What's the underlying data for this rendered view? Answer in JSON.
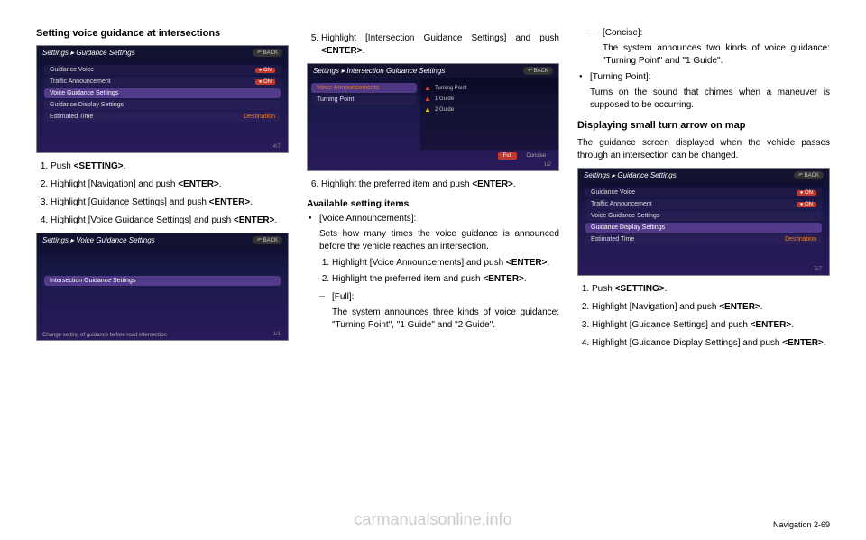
{
  "col1": {
    "heading": "Setting voice guidance at intersections",
    "screenshot1": {
      "title": "Settings",
      "crumb": "Guidance Settings",
      "back": "BACK",
      "items": [
        {
          "label": "Guidance Voice",
          "on": true
        },
        {
          "label": "Traffic Announcement",
          "on": true
        },
        {
          "label": "Voice Guidance Settings",
          "highlighted": true
        },
        {
          "label": "Guidance Display Settings"
        },
        {
          "label": "Estimated Time",
          "right": "Destination"
        }
      ],
      "pager": "4/7"
    },
    "steps1": [
      "Push <SETTING>.",
      "Highlight [Navigation] and push <ENTER>.",
      "Highlight [Guidance Settings] and push <ENTER>.",
      "Highlight [Voice Guidance Settings] and push <ENTER>."
    ],
    "screenshot2": {
      "title": "Settings",
      "crumb": "Voice Guidance Settings",
      "back": "BACK",
      "items": [
        {
          "label": "Intersection Guidance Settings",
          "highlighted": true
        }
      ],
      "hint": "Change setting of guidance before road intersection",
      "pager": "1/1"
    }
  },
  "col2": {
    "step5": "Highlight [Intersection Guidance Settings] and push <ENTER>.",
    "screenshot3": {
      "title": "Settings",
      "crumb": "Intersection Guidance Settings",
      "back": "BACK",
      "leftItems": [
        {
          "label": "Voice Announcements",
          "highlighted": true,
          "orange": true
        },
        {
          "label": "Turning Point"
        }
      ],
      "rightItems": [
        "Turning Point",
        "1 Guide",
        "2 Guide"
      ],
      "options": [
        "Full",
        "Concise"
      ],
      "selected": 0,
      "pager": "1/2"
    },
    "step6": "Highlight the preferred item and push <ENTER>.",
    "availHeading": "Available setting items",
    "bullet1": {
      "title": "[Voice Announcements]:",
      "desc": "Sets how many times the voice guidance is announced before the vehicle reaches an intersection.",
      "substeps": [
        "Highlight [Voice Announcements] and push <ENTER>.",
        "Highlight the preferred item and push <ENTER>."
      ],
      "dash1": {
        "title": "[Full]:",
        "desc": "The system announces three kinds of voice guidance: \"Turning Point\", \"1 Guide\" and \"2 Guide\"."
      }
    }
  },
  "col3": {
    "dash2": {
      "title": "[Concise]:",
      "desc": "The system announces two kinds of voice guidance: \"Turning Point\" and \"1 Guide\"."
    },
    "bullet2": {
      "title": "[Turning Point]:",
      "desc": "Turns on the sound that chimes when a maneuver is supposed to be occurring."
    },
    "heading2": "Displaying small turn arrow on map",
    "para": "The guidance screen displayed when the vehicle passes through an intersection can be changed.",
    "screenshot4": {
      "title": "Settings",
      "crumb": "Guidance Settings",
      "back": "BACK",
      "items": [
        {
          "label": "Guidance Voice",
          "on": true
        },
        {
          "label": "Traffic Announcement",
          "on": true
        },
        {
          "label": "Voice Guidance Settings"
        },
        {
          "label": "Guidance Display Settings",
          "highlighted": true
        },
        {
          "label": "Estimated Time",
          "right": "Destination"
        }
      ],
      "pager": "5/7"
    },
    "steps2": [
      "Push <SETTING>.",
      "Highlight [Navigation] and push <ENTER>.",
      "Highlight [Guidance Settings] and push <ENTER>.",
      "Highlight [Guidance Display Settings] and push <ENTER>."
    ]
  },
  "footer": {
    "watermark": "carmanualsonline.info",
    "pagenum": "Navigation   2-69"
  }
}
